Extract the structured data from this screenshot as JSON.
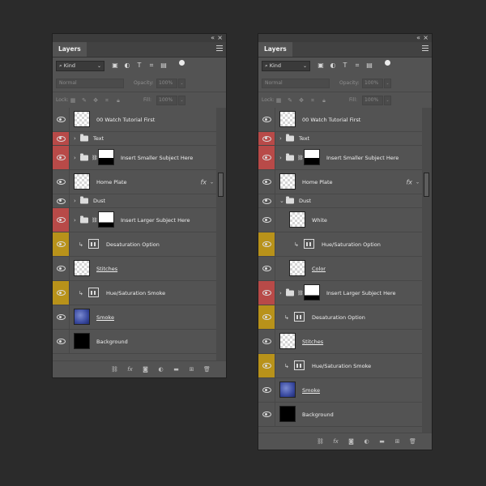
{
  "colors": {
    "background": "#2b2b2b",
    "panel": "#535353",
    "red": "#b84a48",
    "yellow": "#b8921a"
  },
  "panel_header": {
    "tab_label": "Layers",
    "collapse_glyph": "«",
    "close_glyph": "×"
  },
  "filter": {
    "kind_label": "Kind"
  },
  "blend": {
    "mode": "Normal",
    "opacity_label": "Opacity:",
    "opacity_value": "100%"
  },
  "lock": {
    "label": "Lock:",
    "fill_label": "Fill:",
    "fill_value": "100%"
  },
  "bottom_icons": [
    "link-icon",
    "fx-icon",
    "mask-icon",
    "adjustment-icon",
    "folder-icon",
    "new-layer-icon",
    "trash-icon"
  ],
  "left": {
    "layers": [
      {
        "name": "00 Watch Tutorial First",
        "color": "none",
        "type": "image",
        "thumb": "checker"
      },
      {
        "name": "Text",
        "color": "red",
        "type": "group"
      },
      {
        "name": "Insert Smaller Subject Here",
        "color": "red",
        "type": "group-mask",
        "thumb": "mask"
      },
      {
        "name": "Home Plate",
        "color": "none",
        "type": "image",
        "thumb": "checker",
        "fx": "fx"
      },
      {
        "name": "Dust",
        "color": "none",
        "type": "group"
      },
      {
        "name": "Insert Larger Subject Here",
        "color": "red",
        "type": "group-mask",
        "thumb": "mask2"
      },
      {
        "name": "Desaturation Option",
        "color": "yellow",
        "type": "adjustment"
      },
      {
        "name": "Stitches",
        "color": "none",
        "type": "image",
        "thumb": "checker",
        "underline": true
      },
      {
        "name": "Hue/Saturation Smoke",
        "color": "yellow",
        "type": "adjustment"
      },
      {
        "name": "Smoke",
        "color": "none",
        "type": "image",
        "thumb": "smoke",
        "underline": true
      },
      {
        "name": "Background",
        "color": "none",
        "type": "image",
        "thumb": "black"
      }
    ]
  },
  "right": {
    "layers": [
      {
        "name": "00 Watch Tutorial First",
        "color": "none",
        "type": "image",
        "thumb": "checker"
      },
      {
        "name": "Text",
        "color": "red",
        "type": "group"
      },
      {
        "name": "Insert Smaller Subject Here",
        "color": "red",
        "type": "group-mask",
        "thumb": "mask"
      },
      {
        "name": "Home Plate",
        "color": "none",
        "type": "image",
        "thumb": "checker",
        "fx": "fx"
      },
      {
        "name": "Dust",
        "color": "none",
        "type": "group-open"
      },
      {
        "name": "White",
        "color": "none",
        "type": "image-indent",
        "thumb": "checker"
      },
      {
        "name": "Hue/Saturation Option",
        "color": "yellow",
        "type": "adjustment-indent"
      },
      {
        "name": "Color",
        "color": "none",
        "type": "image-indent",
        "thumb": "checker",
        "underline": true
      },
      {
        "name": "Insert Larger Subject Here",
        "color": "red",
        "type": "group-mask",
        "thumb": "mask2"
      },
      {
        "name": "Desaturation Option",
        "color": "yellow",
        "type": "adjustment"
      },
      {
        "name": "Stitches",
        "color": "none",
        "type": "image",
        "thumb": "checker",
        "underline": true
      },
      {
        "name": "Hue/Saturation Smoke",
        "color": "yellow",
        "type": "adjustment"
      },
      {
        "name": "Smoke",
        "color": "none",
        "type": "image",
        "thumb": "smoke",
        "underline": true
      },
      {
        "name": "Background",
        "color": "none",
        "type": "image",
        "thumb": "black"
      }
    ]
  }
}
